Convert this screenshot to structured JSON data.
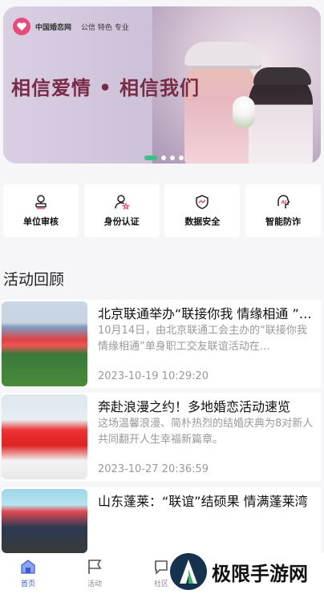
{
  "banner": {
    "brand_name": "中国婚恋网",
    "brand_tag": "公信 特色 专业",
    "slogan": "相信爱情 • 相信我们",
    "slide_count": 4,
    "active_slide": 1
  },
  "features": [
    {
      "label": "单位审核",
      "icon": "stamp-icon"
    },
    {
      "label": "身份认证",
      "icon": "user-verify-icon"
    },
    {
      "label": "数据安全",
      "icon": "shield-icon"
    },
    {
      "label": "智能防诈",
      "icon": "ai-head-icon"
    }
  ],
  "section": {
    "title": "活动回顾"
  },
  "articles": [
    {
      "title": "北京联通举办“联接你我 情缘相通 ”…",
      "desc": "10月14日，由北京联通工会主办的“联接你我 情缘相通”单身职工交友联谊活动在…",
      "time": "2023-10-19 10:29:20"
    },
    {
      "title": "奔赴浪漫之约！多地婚恋活动速览",
      "desc": "这场温馨浪漫、简朴热烈的结婚庆典为8对新人共同翻开人生幸福新篇章。",
      "time": "2023-10-27 20:36:59"
    },
    {
      "title": "山东蓬莱：“联谊”结硕果 情满蓬莱湾",
      "desc": "",
      "time": ""
    }
  ],
  "tabbar": {
    "items": [
      {
        "label": "首页",
        "icon": "home-icon",
        "active": true
      },
      {
        "label": "活动",
        "icon": "flag-icon",
        "active": false
      },
      {
        "label": "社区",
        "icon": "chat-icon",
        "active": false
      }
    ]
  },
  "watermark": {
    "text": "极限手游网"
  },
  "colors": {
    "accent": "#3cc08a",
    "brand": "#e84a7a",
    "tab_active": "#3a5bd8"
  }
}
